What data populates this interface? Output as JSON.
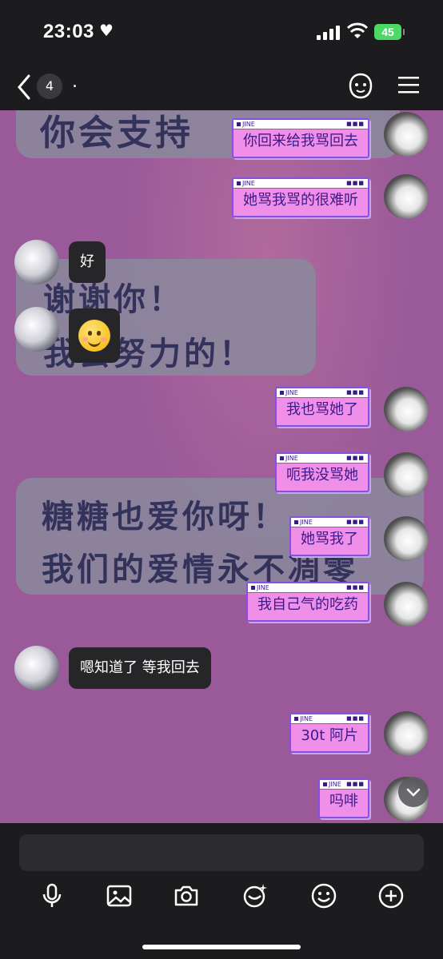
{
  "status": {
    "time": "23:03",
    "battery": "45"
  },
  "nav": {
    "unread_count": "4",
    "title": "."
  },
  "background_text": {
    "line1": "你会支持",
    "line2": "谢谢你！",
    "line3": "我会努力的！",
    "line4": "糖糖也爱你呀！",
    "line5": "我们的爱情永不凋零"
  },
  "messages": [
    {
      "side": "out",
      "text": "你回来给我骂回去"
    },
    {
      "side": "out",
      "text": "她骂我骂的很难听"
    },
    {
      "side": "in",
      "text": "好"
    },
    {
      "side": "in",
      "emoji": "smiley-emoji"
    },
    {
      "side": "out",
      "text": "我也骂她了"
    },
    {
      "side": "out",
      "text": "呃我没骂她"
    },
    {
      "side": "out",
      "text": "她骂我了"
    },
    {
      "side": "out",
      "text": "我自己气的吃药"
    },
    {
      "side": "in",
      "text": "嗯知道了 等我回去"
    },
    {
      "side": "out",
      "text": "30t 阿片"
    },
    {
      "side": "out",
      "text": "吗啡"
    }
  ],
  "bubble_window_tag": "JINE",
  "toolbar": [
    "mic-icon",
    "image-icon",
    "camera-icon",
    "sticker-icon",
    "emoji-icon",
    "plus-icon"
  ],
  "colors": {
    "bubble_out": "#f08fe8",
    "bubble_border": "#8a4fe0",
    "bubble_in": "#262628",
    "chat_bg": "#9a5a9a"
  }
}
